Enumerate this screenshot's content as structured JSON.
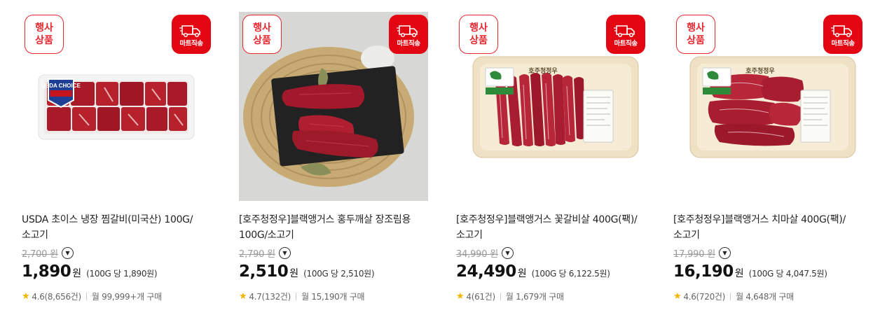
{
  "badges": {
    "event_line1": "행사",
    "event_line2": "상품",
    "mart": "마트직송"
  },
  "products": [
    {
      "title": "USDA 초이스 냉장 찜갈비(미국산) 100G/소고기",
      "original_price": "2,700 원",
      "sale_price": "1,890",
      "currency": "원",
      "unit_price": "(100G 당 1,890원)",
      "rating": "4.6(8,656건)",
      "monthly": "월 99,999+개 구매",
      "image_icon": "usda-ribs-tray",
      "package_label": "USDA CHOICE"
    },
    {
      "title": "[호주청정우]블랙앵거스 홍두깨살 장조림용 100G/소고기",
      "original_price": "2,790 원",
      "sale_price": "2,510",
      "currency": "원",
      "unit_price": "(100G 당 2,510원)",
      "rating": "4.7(132건)",
      "monthly": "월 15,190개 구매",
      "image_icon": "beef-on-slate-photo"
    },
    {
      "title": "[호주청정우]블랙앵거스 꽃갈비살 400G(팩)/소고기",
      "original_price": "34,990 원",
      "sale_price": "24,490",
      "currency": "원",
      "unit_price": "(100G 당 6,122.5원)",
      "rating": "4(61건)",
      "monthly": "월 1,679개 구매",
      "image_icon": "aussie-beef-tray",
      "package_label": "호주청정우"
    },
    {
      "title": "[호주청정우]블랙앵거스 치마살 400G(팩)/소고기",
      "original_price": "17,990 원",
      "sale_price": "16,190",
      "currency": "원",
      "unit_price": "(100G 당 4,047.5원)",
      "rating": "4.6(720건)",
      "monthly": "월 4,648개 구매",
      "image_icon": "aussie-beef-tray",
      "package_label": "호주청정우"
    }
  ],
  "colors": {
    "brand_red": "#e30613",
    "star": "#f4b400"
  }
}
